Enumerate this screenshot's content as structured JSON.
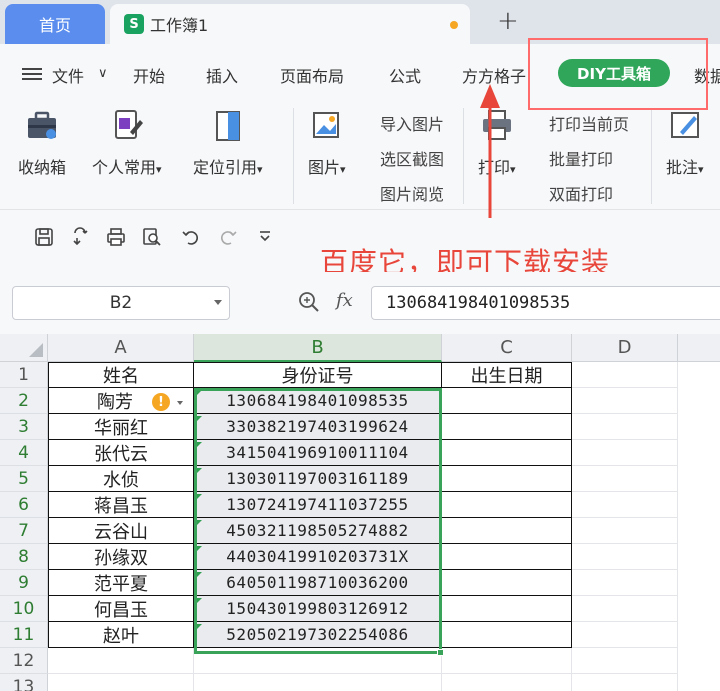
{
  "tabs": {
    "home_label": "首页",
    "doc_icon_letter": "S",
    "doc_label": "工作簿1",
    "new_tab": "+"
  },
  "menu": {
    "file": "文件",
    "file_caret": "∨",
    "items": [
      "开始",
      "插入",
      "页面布局",
      "公式",
      "方方格子"
    ],
    "diy": "DIY工具箱",
    "data_partial": "数据"
  },
  "ribbon": {
    "storage_box": "收纳箱",
    "personal_common": "个人常用",
    "locate_ref": "定位引用",
    "picture": "图片",
    "import_picture": "导入图片",
    "region_screenshot": "选区截图",
    "picture_browse": "图片阅览",
    "print": "打印",
    "print_current_page": "打印当前页",
    "batch_print": "批量打印",
    "duplex_print": "双面打印",
    "annotate": "批注",
    "dropdown_caret": "▾"
  },
  "annotation": {
    "note_text": "百度它，即可下载安装",
    "arrow_color": "#e8463a"
  },
  "formula_bar": {
    "name_box": "B2",
    "fx": "fx",
    "formula_value": "130684198401098535"
  },
  "grid": {
    "columns": [
      "A",
      "B",
      "C",
      "D"
    ],
    "rows": [
      "1",
      "2",
      "3",
      "4",
      "5",
      "6",
      "7",
      "8",
      "9",
      "10",
      "11",
      "12",
      "13"
    ],
    "header": [
      "姓名",
      "身份证号",
      "出生日期"
    ],
    "records": [
      {
        "name": "陶芳",
        "id": "130684198401098535"
      },
      {
        "name": "华丽红",
        "id": "330382197403199624"
      },
      {
        "name": "张代云",
        "id": "341504196910011104"
      },
      {
        "name": "水侦",
        "id": "130301197003161189"
      },
      {
        "name": "蒋昌玉",
        "id": "130724197411037255"
      },
      {
        "name": "云谷山",
        "id": "450321198505274882"
      },
      {
        "name": "孙缘双",
        "id": "44030419910203731X"
      },
      {
        "name": "范平夏",
        "id": "640501198710036200"
      },
      {
        "name": "何昌玉",
        "id": "150430199803126912"
      },
      {
        "name": "赵叶",
        "id": "520502197302254086"
      }
    ],
    "warning_symbol": "!",
    "accent_color": "#3aa35a"
  }
}
